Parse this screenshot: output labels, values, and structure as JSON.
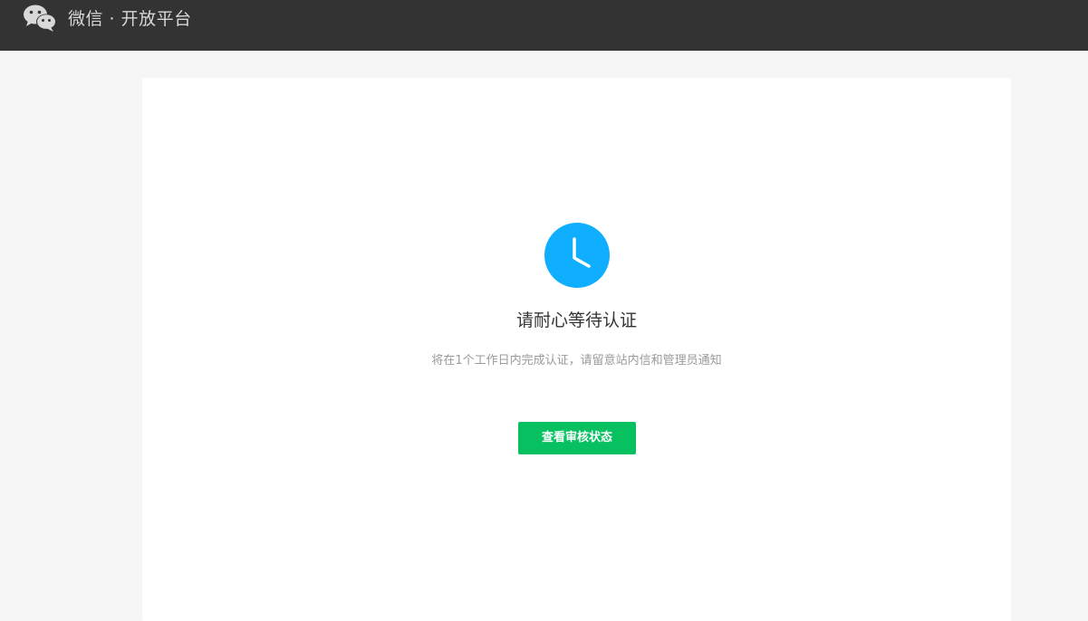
{
  "header": {
    "brand_title": "微信 · 开放平台",
    "logo_icon": "wechat-logo-icon",
    "background_color": "#333333"
  },
  "main": {
    "status_icon": "clock-icon",
    "status_icon_color": "#10aeff",
    "title": "请耐心等待认证",
    "description": "将在1个工作日内完成认证，请留意站内信和管理员通知",
    "button_label": "查看审核状态",
    "button_color": "#07c160"
  }
}
